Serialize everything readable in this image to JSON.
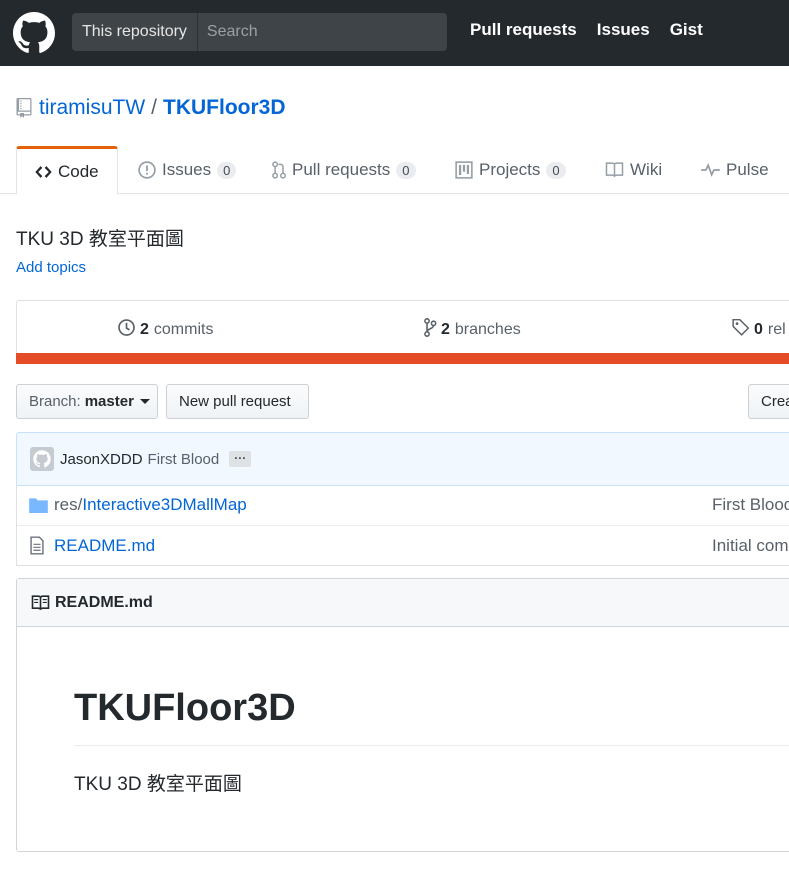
{
  "header": {
    "search_scope": "This repository",
    "search_placeholder": "Search",
    "nav": [
      "Pull requests",
      "Issues",
      "Gist"
    ]
  },
  "repo": {
    "owner": "tiramisuTW",
    "separator": "/",
    "name": "TKUFloor3D"
  },
  "tabs": [
    {
      "label": "Code",
      "icon": "code-icon"
    },
    {
      "label": "Issues",
      "count": "0",
      "icon": "issue-icon"
    },
    {
      "label": "Pull requests",
      "count": "0",
      "icon": "pull-request-icon"
    },
    {
      "label": "Projects",
      "count": "0",
      "icon": "project-icon"
    },
    {
      "label": "Wiki",
      "icon": "book-icon"
    },
    {
      "label": "Pulse",
      "icon": "pulse-icon"
    }
  ],
  "description": "TKU 3D 教室平面圖",
  "add_topics": "Add topics",
  "summary": {
    "commits_count": "2",
    "commits_label": "commits",
    "branches_count": "2",
    "branches_label": "branches",
    "releases_count": "0",
    "releases_label": "rel",
    "language_color": "#e34c26"
  },
  "toolbar": {
    "branch_prefix": "Branch:",
    "branch_name": "master",
    "new_pr": "New pull request",
    "create": "Crea"
  },
  "latest_commit": {
    "author": "JasonXDDD",
    "message": "First Blood",
    "ellipsis": "···"
  },
  "files": [
    {
      "type": "dir",
      "prefix": "res/",
      "name": "Interactive3DMallMap",
      "message": "First Blood"
    },
    {
      "type": "file",
      "prefix": "",
      "name": "README.md",
      "message": "Initial com"
    }
  ],
  "readme": {
    "header": "README.md",
    "title": "TKUFloor3D",
    "body": "TKU 3D 教室平面圖"
  }
}
